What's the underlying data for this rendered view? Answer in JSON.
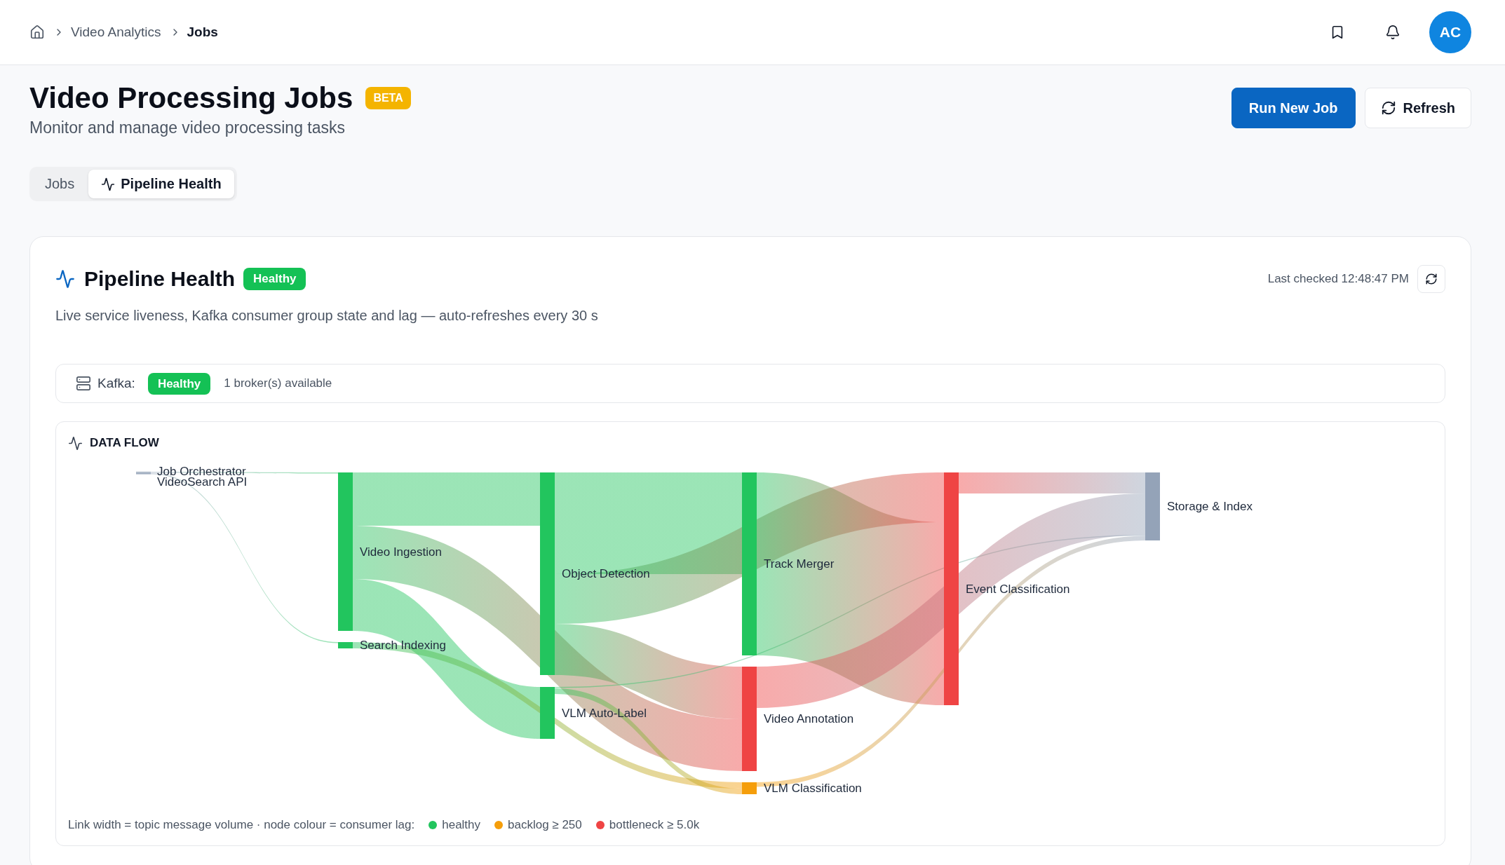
{
  "breadcrumb": [
    {
      "label": "Video Analytics",
      "current": false
    },
    {
      "label": "Jobs",
      "current": true
    }
  ],
  "user": {
    "initials": "AC"
  },
  "page": {
    "title": "Video Processing Jobs",
    "badge": "BETA",
    "subtitle": "Monitor and manage video processing tasks"
  },
  "actions": [
    {
      "label": "Run New Job",
      "kind": "primary"
    },
    {
      "label": "Refresh",
      "kind": "secondary"
    }
  ],
  "tabs": [
    {
      "label": "Jobs",
      "selected": false
    },
    {
      "label": "Pipeline Health",
      "selected": true
    }
  ],
  "pipeline_health": {
    "title": "Pipeline Health",
    "status": "Healthy",
    "last_checked": "Last checked 12:48:47 PM",
    "description": "Live service liveness, Kafka consumer group state and lag — auto-refreshes every 30 s",
    "kafka": {
      "label": "Kafka:",
      "status": "Healthy",
      "detail": "1 broker(s) available"
    },
    "data_flow": {
      "title": "DATA FLOW",
      "nodes": [
        {
          "label": "Job Orchestrator",
          "color": "#94a3b8"
        },
        {
          "label": "VideoSearch API",
          "color": "#94a3b8"
        },
        {
          "label": "Video Ingestion",
          "color": "#22c55e"
        },
        {
          "label": "Search Indexing",
          "color": "#22c55e"
        },
        {
          "label": "Object Detection",
          "color": "#22c55e"
        },
        {
          "label": "VLM Auto-Label",
          "color": "#22c55e"
        },
        {
          "label": "Track Merger",
          "color": "#22c55e"
        },
        {
          "label": "Video Annotation",
          "color": "#ef4444"
        },
        {
          "label": "VLM Classification",
          "color": "#f59e0b"
        },
        {
          "label": "Event Classification",
          "color": "#ef4444"
        },
        {
          "label": "Storage & Index",
          "color": "#94a3b8"
        }
      ],
      "legend": {
        "text": "Link width = topic message volume · node colour = consumer lag:",
        "items": [
          {
            "label": "healthy",
            "color": "#22c55e"
          },
          {
            "label": "backlog ≥ 250",
            "color": "#f59e0b"
          },
          {
            "label": "bottleneck ≥ 5.0k",
            "color": "#ef4444"
          }
        ]
      }
    }
  }
}
